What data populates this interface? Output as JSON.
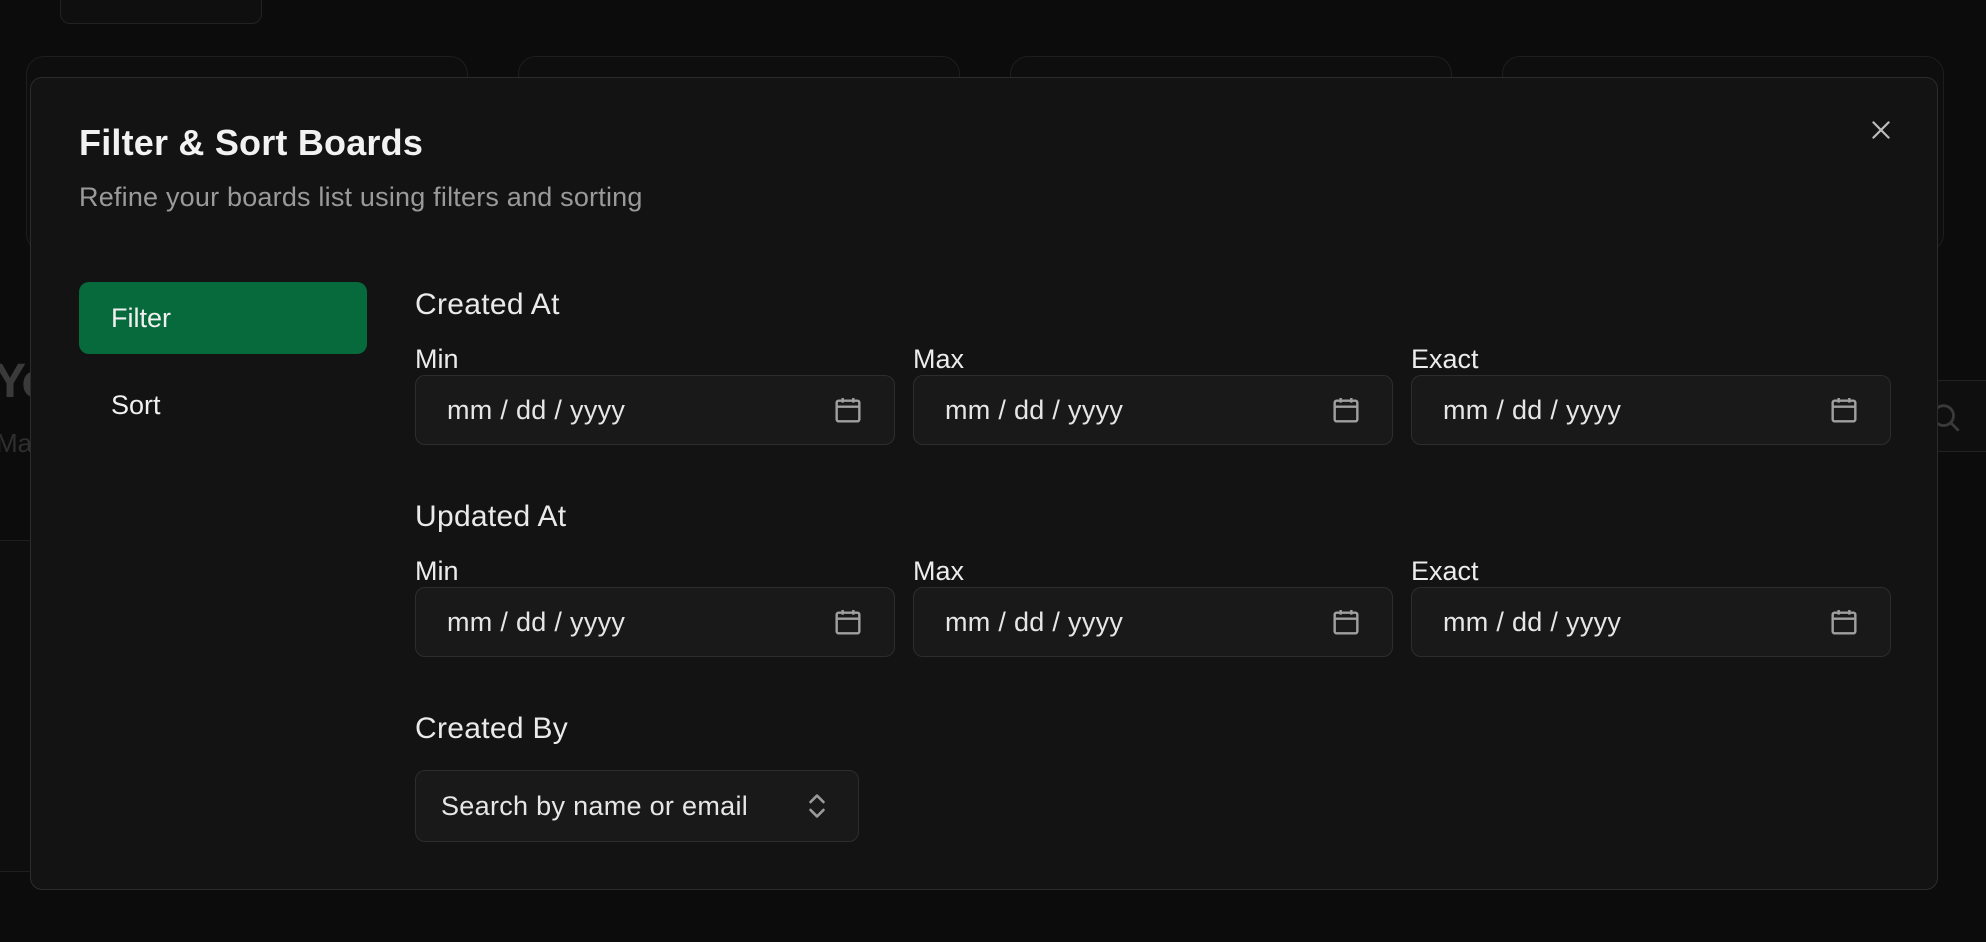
{
  "modal": {
    "title": "Filter & Sort Boards",
    "description": "Refine your boards list using filters and sorting",
    "close_icon": "close-icon"
  },
  "tabs": [
    {
      "label": "Filter",
      "active": true
    },
    {
      "label": "Sort",
      "active": false
    }
  ],
  "filters": {
    "created_at": {
      "label": "Created At",
      "min_label": "Min",
      "max_label": "Max",
      "exact_label": "Exact",
      "min_placeholder": "mm / dd / yyyy",
      "max_placeholder": "mm / dd / yyyy",
      "exact_placeholder": "mm / dd / yyyy"
    },
    "updated_at": {
      "label": "Updated At",
      "min_label": "Min",
      "max_label": "Max",
      "exact_label": "Exact",
      "min_placeholder": "mm / dd / yyyy",
      "max_placeholder": "mm / dd / yyyy",
      "exact_placeholder": "mm / dd / yyyy"
    },
    "created_by": {
      "label": "Created By",
      "placeholder": "Search by name or email"
    }
  },
  "colors": {
    "active_tab": "#076a3c",
    "modal_bg": "#131313",
    "backdrop": "#0c0c0c"
  },
  "icons": {
    "date_picker": "calendar-icon",
    "combo": "chevron-up-down-icon",
    "close": "close-icon"
  }
}
